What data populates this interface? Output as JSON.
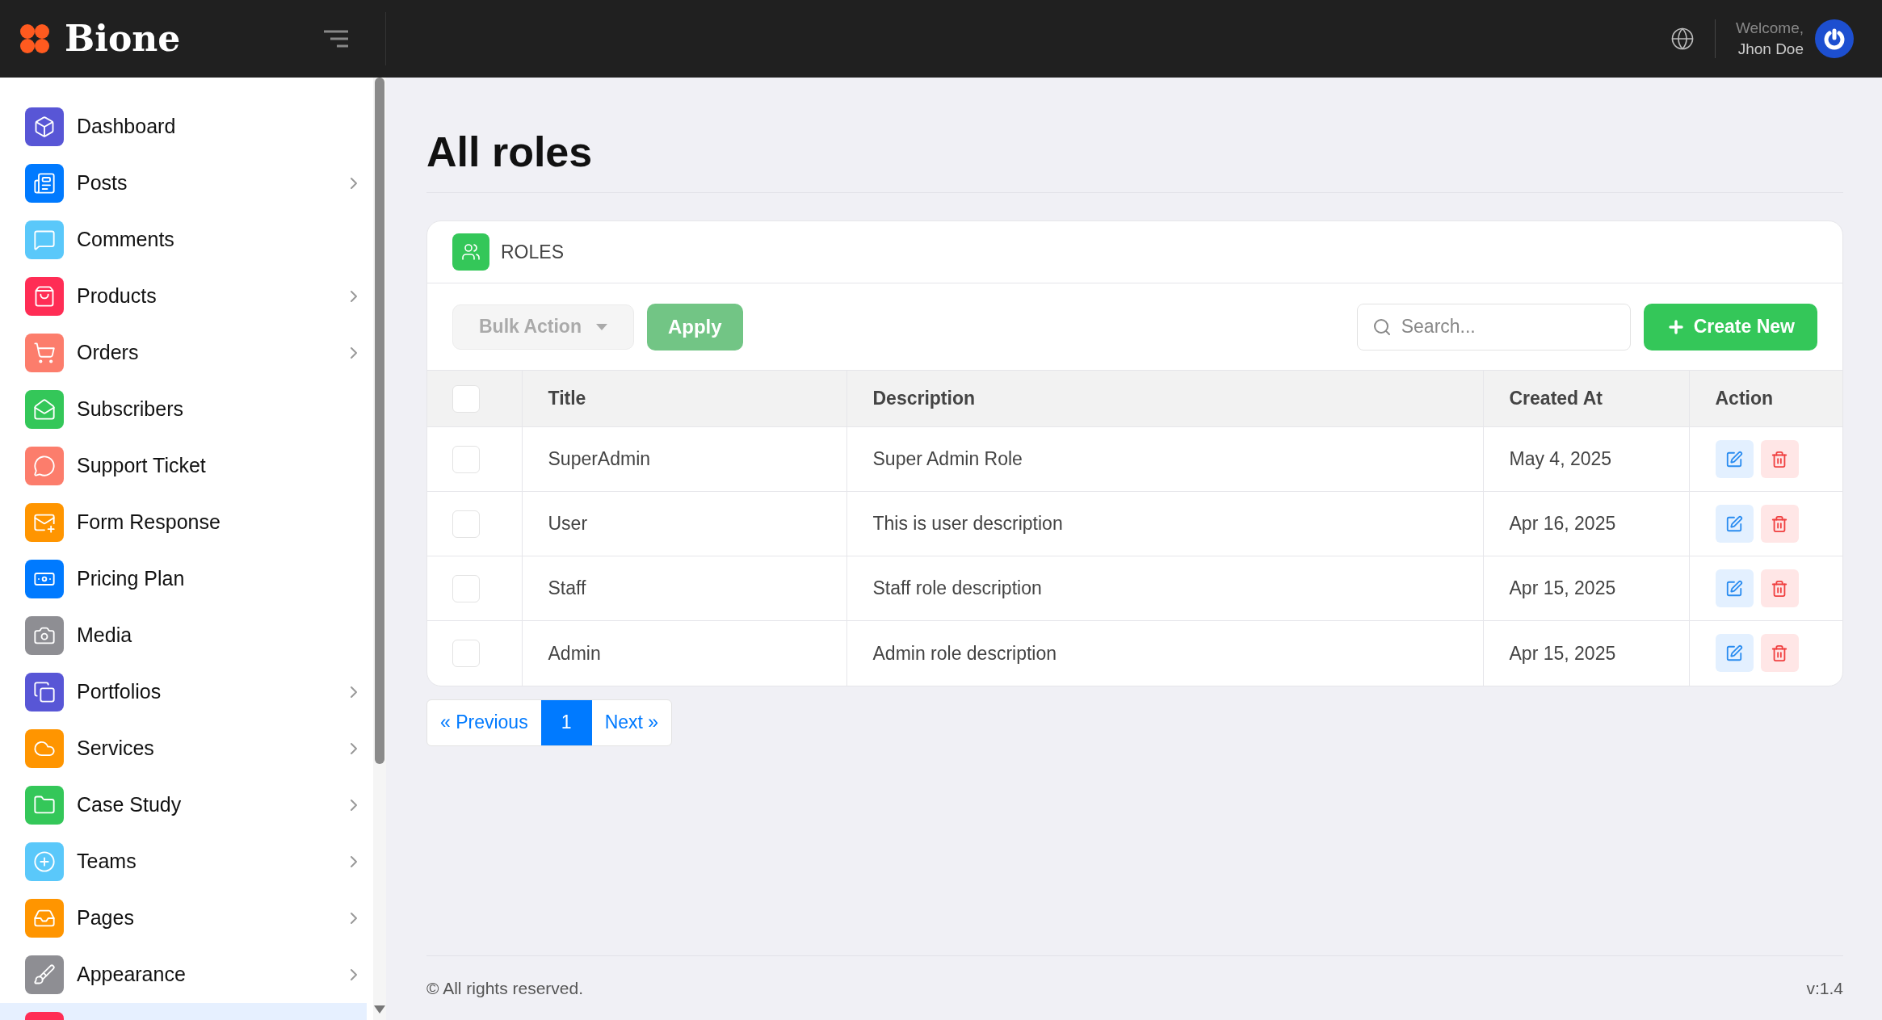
{
  "brand": {
    "name": "Bione"
  },
  "header": {
    "welcome": "Welcome,",
    "user_name": "Jhon Doe"
  },
  "sidebar": {
    "items": [
      {
        "label": "Dashboard",
        "color": "#5856d6",
        "expandable": false,
        "selected": false
      },
      {
        "label": "Posts",
        "color": "#007aff",
        "expandable": true,
        "selected": false
      },
      {
        "label": "Comments",
        "color": "#5ac8fa",
        "expandable": false,
        "selected": false
      },
      {
        "label": "Products",
        "color": "#ff2d55",
        "expandable": true,
        "selected": false
      },
      {
        "label": "Orders",
        "color": "#fc7d6c",
        "expandable": true,
        "selected": false
      },
      {
        "label": "Subscribers",
        "color": "#34c759",
        "expandable": false,
        "selected": false
      },
      {
        "label": "Support Ticket",
        "color": "#fc7d6c",
        "expandable": false,
        "selected": false
      },
      {
        "label": "Form Response",
        "color": "#ff9500",
        "expandable": false,
        "selected": false
      },
      {
        "label": "Pricing Plan",
        "color": "#007aff",
        "expandable": false,
        "selected": false
      },
      {
        "label": "Media",
        "color": "#8e8e93",
        "expandable": false,
        "selected": false
      },
      {
        "label": "Portfolios",
        "color": "#5856d6",
        "expandable": true,
        "selected": false
      },
      {
        "label": "Services",
        "color": "#ff9500",
        "expandable": true,
        "selected": false
      },
      {
        "label": "Case Study",
        "color": "#34c759",
        "expandable": true,
        "selected": false
      },
      {
        "label": "Teams",
        "color": "#5ac8fa",
        "expandable": true,
        "selected": false
      },
      {
        "label": "Pages",
        "color": "#ff9500",
        "expandable": true,
        "selected": false
      },
      {
        "label": "Appearance",
        "color": "#8e8e93",
        "expandable": true,
        "selected": false
      },
      {
        "color": "#ff2d55",
        "expandable": false,
        "selected": true
      }
    ]
  },
  "page": {
    "title": "All roles"
  },
  "card": {
    "title": "ROLES",
    "bulk_action": "Bulk Action",
    "apply": "Apply",
    "search": {
      "placeholder": "Search..."
    },
    "create_button": "Create New",
    "table": {
      "select_all_checked": false,
      "columns": [
        "Title",
        "Description",
        "Created At",
        "Action"
      ],
      "rows": [
        {
          "checked": false,
          "title": "SuperAdmin",
          "description": "Super Admin Role",
          "created_at": "May 4, 2025"
        },
        {
          "checked": false,
          "title": "User",
          "description": "This is user description",
          "created_at": "Apr 16, 2025"
        },
        {
          "checked": false,
          "title": "Staff",
          "description": "Staff role description",
          "created_at": "Apr 15, 2025"
        },
        {
          "checked": false,
          "title": "Admin",
          "description": "Admin role description",
          "created_at": "Apr 15, 2025"
        }
      ]
    }
  },
  "pagination": {
    "previous": "« Previous",
    "pages": [
      {
        "label": "1",
        "selected": true
      }
    ],
    "next": "Next »"
  },
  "footer": {
    "copyright": "© All rights reserved.",
    "version": "v:1.4"
  }
}
